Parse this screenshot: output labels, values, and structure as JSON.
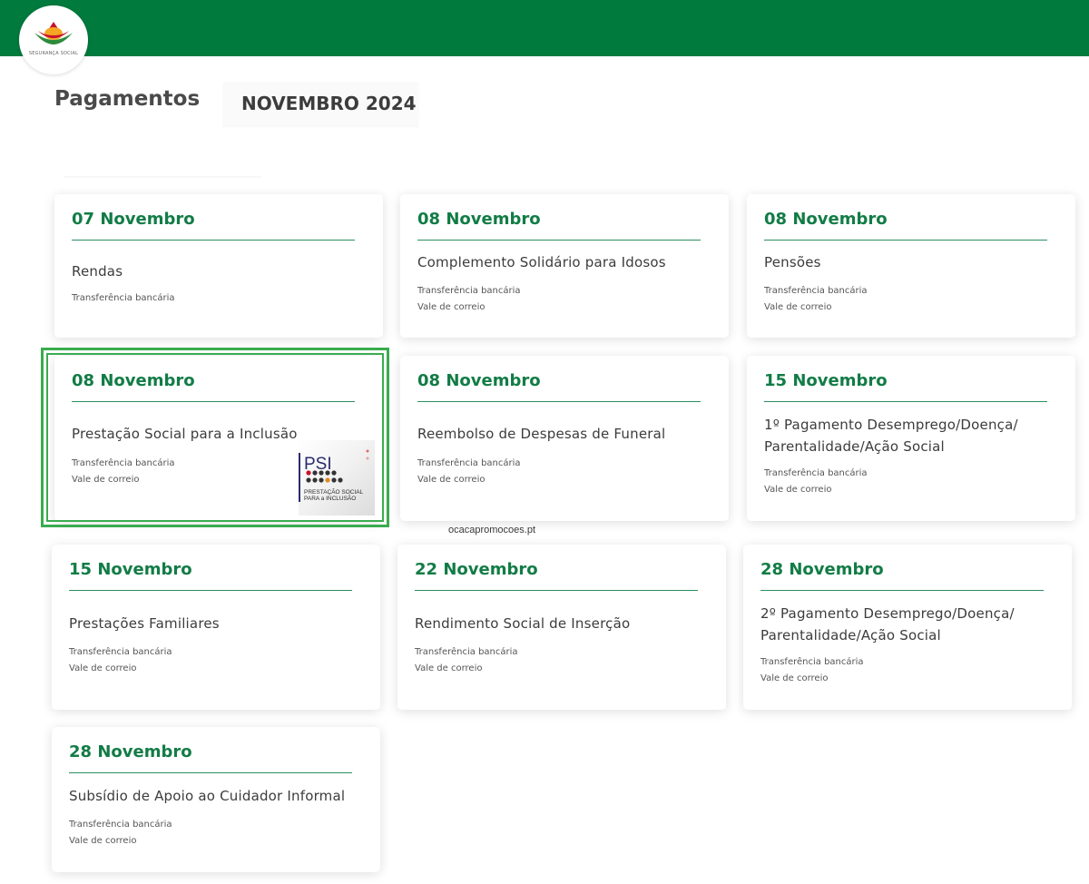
{
  "header": {
    "brand_color": "#007a3d",
    "logo_text": "SEGURANÇA SOCIAL"
  },
  "page": {
    "title": "Pagamentos",
    "month": "NOVEMBRO 2024"
  },
  "accent_color": "#127c46",
  "highlight_color": "#3aac4e",
  "cards": [
    {
      "date": "07 Novembro",
      "title_lines": [
        "Rendas"
      ],
      "methods": [
        "Transferência bancária"
      ]
    },
    {
      "date": "08 Novembro",
      "title_lines": [
        "Complemento Solidário para Idosos"
      ],
      "methods": [
        "Transferência bancária",
        "Vale de correio"
      ]
    },
    {
      "date": "08 Novembro",
      "title_lines": [
        "Pensões"
      ],
      "methods": [
        "Transferência bancária",
        "Vale de correio"
      ]
    },
    {
      "date": "08 Novembro",
      "title_lines": [
        "Prestação Social para a Inclusão"
      ],
      "methods": [
        "Transferência bancária",
        "Vale de correio"
      ],
      "highlighted": true
    },
    {
      "date": "08 Novembro",
      "title_lines": [
        "Reembolso de Despesas de Funeral"
      ],
      "methods": [
        "Transferência bancária",
        "Vale de correio"
      ]
    },
    {
      "date": "15 Novembro",
      "title_lines": [
        "1º Pagamento Desemprego/Doença/",
        "Parentalidade/Ação Social"
      ],
      "methods": [
        "Transferência bancária",
        "Vale de correio"
      ]
    },
    {
      "date": "15 Novembro",
      "title_lines": [
        "Prestações Familiares"
      ],
      "methods": [
        "Transferência bancária",
        "Vale de correio"
      ]
    },
    {
      "date": "22 Novembro",
      "title_lines": [
        "Rendimento Social de Inserção"
      ],
      "methods": [
        "Transferência bancária",
        "Vale de correio"
      ]
    },
    {
      "date": "28 Novembro",
      "title_lines": [
        "2º Pagamento Desemprego/Doença/",
        "Parentalidade/Ação Social"
      ],
      "methods": [
        "Transferência bancária",
        "Vale de correio"
      ]
    },
    {
      "date": "28 Novembro",
      "title_lines": [
        "Subsídio de Apoio ao Cuidador Informal"
      ],
      "methods": [
        "Transferência bancária",
        "Vale de correio"
      ]
    }
  ],
  "psi_logo": {
    "acronym": "PSI",
    "line1": "PRESTAÇÃO SOCIAL",
    "line2": "PARA a INCLUSÃO"
  },
  "watermark": "ocacapromocoes.pt"
}
